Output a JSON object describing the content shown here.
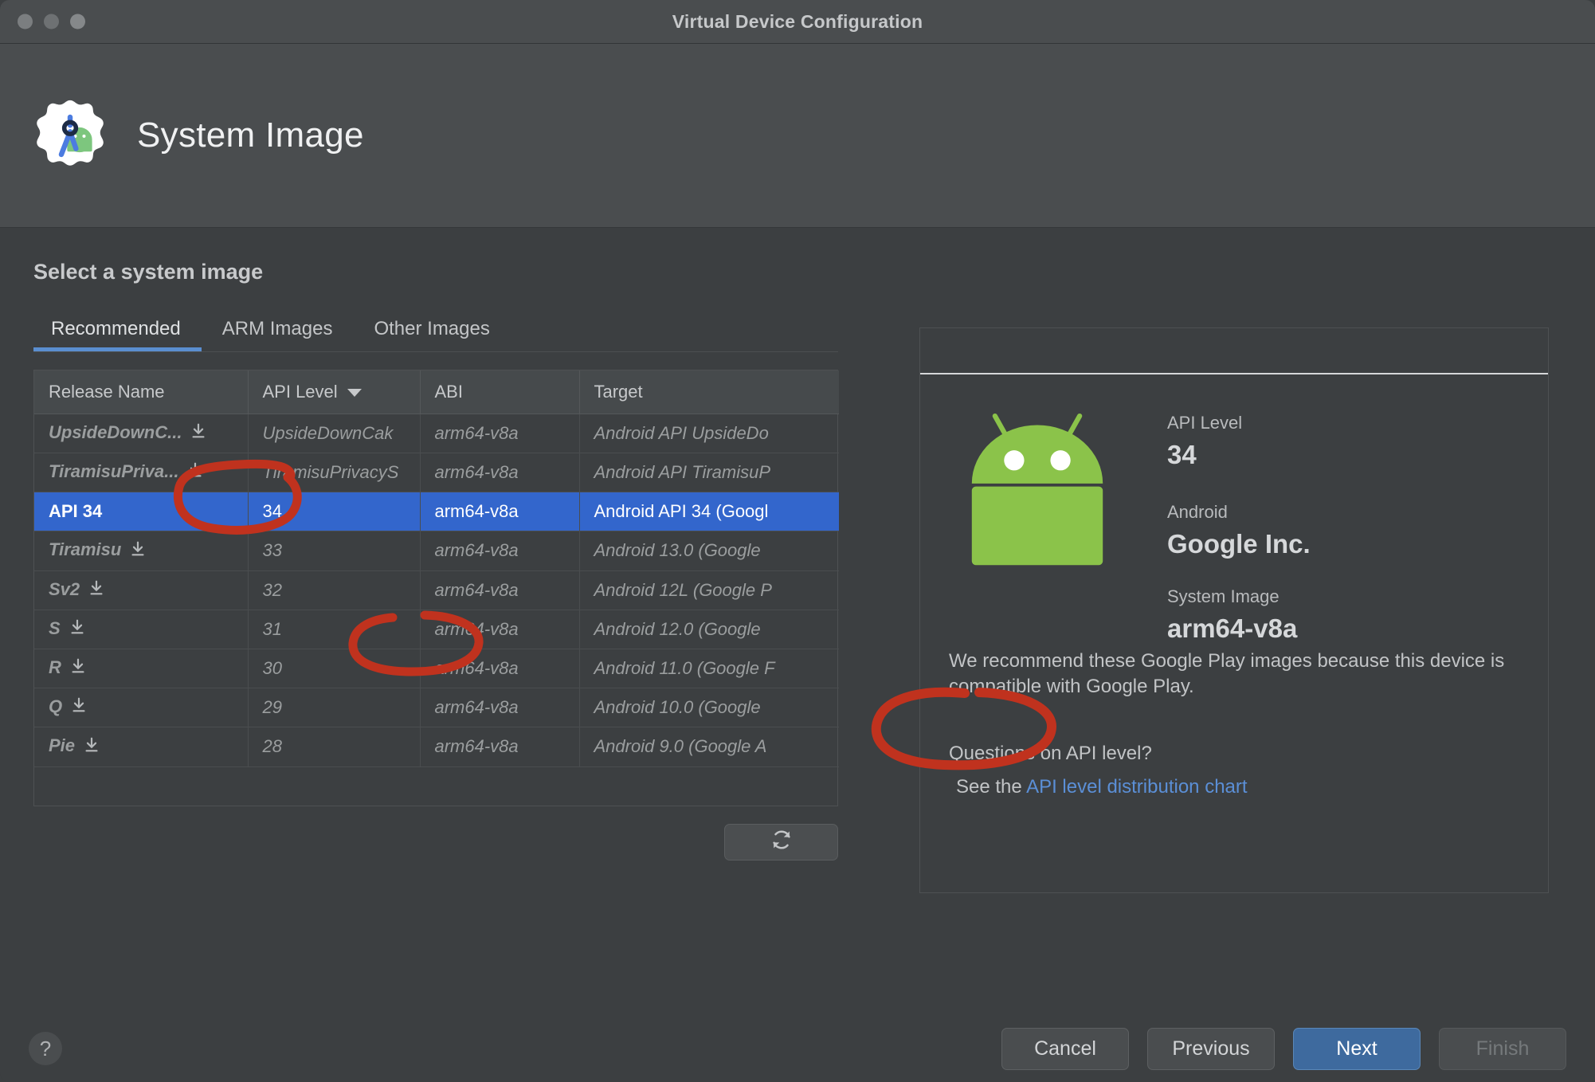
{
  "window": {
    "title": "Virtual Device Configuration"
  },
  "header": {
    "page_title": "System Image",
    "logo_icon": "android-studio-logo-icon"
  },
  "main": {
    "section_title": "Select a system image",
    "tabs": [
      {
        "label": "Recommended",
        "active": true
      },
      {
        "label": "ARM Images",
        "active": false
      },
      {
        "label": "Other Images",
        "active": false
      }
    ],
    "table": {
      "columns": [
        "Release Name",
        "API Level",
        "ABI",
        "Target"
      ],
      "sort_column": "API Level",
      "sort_direction": "descending",
      "rows": [
        {
          "release_name": "UpsideDownC...",
          "downloadable": true,
          "api_level": "UpsideDownCak",
          "abi": "arm64-v8a",
          "target": "Android API UpsideDo",
          "state": "not-installed"
        },
        {
          "release_name": "TiramisuPriva...",
          "downloadable": true,
          "api_level": "TiramisuPrivacyS",
          "abi": "arm64-v8a",
          "target": "Android API TiramisuP",
          "state": "not-installed"
        },
        {
          "release_name": "API 34",
          "downloadable": false,
          "api_level": "34",
          "abi": "arm64-v8a",
          "target": "Android API 34 (Googl",
          "state": "selected"
        },
        {
          "release_name": "Tiramisu",
          "downloadable": true,
          "api_level": "33",
          "abi": "arm64-v8a",
          "target": "Android 13.0 (Google ",
          "state": "not-installed"
        },
        {
          "release_name": "Sv2",
          "downloadable": true,
          "api_level": "32",
          "abi": "arm64-v8a",
          "target": "Android 12L (Google P",
          "state": "not-installed"
        },
        {
          "release_name": "S",
          "downloadable": true,
          "api_level": "31",
          "abi": "arm64-v8a",
          "target": "Android 12.0 (Google ",
          "state": "not-installed"
        },
        {
          "release_name": "R",
          "downloadable": true,
          "api_level": "30",
          "abi": "arm64-v8a",
          "target": "Android 11.0 (Google F",
          "state": "not-installed"
        },
        {
          "release_name": "Q",
          "downloadable": true,
          "api_level": "29",
          "abi": "arm64-v8a",
          "target": "Android 10.0 (Google ",
          "state": "not-installed"
        },
        {
          "release_name": "Pie",
          "downloadable": true,
          "api_level": "28",
          "abi": "arm64-v8a",
          "target": "Android 9.0 (Google A",
          "state": "not-installed"
        }
      ]
    },
    "refresh_button": {
      "icon": "refresh-icon",
      "label": ""
    }
  },
  "details": {
    "robot_icon": "android-robot-icon",
    "api_level_label": "API Level",
    "api_level_value": "34",
    "android_label": "Android",
    "android_value": "Google Inc.",
    "system_image_label": "System Image",
    "system_image_value": "arm64-v8a",
    "recommend_text": "We recommend these Google Play images because this device is compatible with Google Play.",
    "question_text": "Questions on API level?",
    "see_the_text": "See the",
    "link_text": "API level distribution chart"
  },
  "footer": {
    "help_label": "?",
    "cancel_label": "Cancel",
    "previous_label": "Previous",
    "next_label": "Next",
    "finish_label": "Finish"
  },
  "annotations": {
    "color": "#c0321e",
    "marks": [
      {
        "name": "circle-arm-images-tab",
        "target": "ARM Images"
      },
      {
        "name": "circle-abi-cell",
        "target": "arm64-v8a"
      },
      {
        "name": "circle-system-image-value",
        "target": "arm64-v8a"
      }
    ]
  },
  "colors": {
    "accent_blue": "#3366cc",
    "tab_underline": "#5a8ed0",
    "link_blue": "#5b8fd6",
    "annotation_red": "#c0321e",
    "window_bg": "#3c3f41",
    "header_bg": "#4a4d4f"
  }
}
